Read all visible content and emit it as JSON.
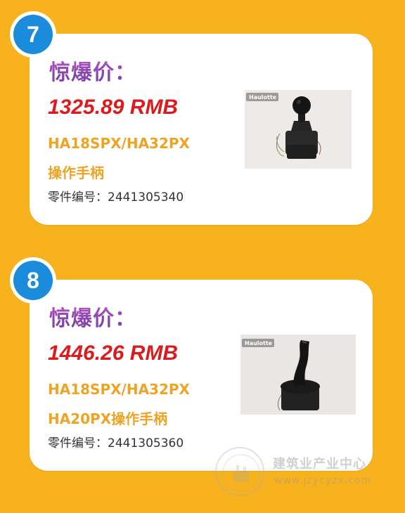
{
  "cards": [
    {
      "number": "7",
      "label": "惊爆价：",
      "price": "1325.89 RMB",
      "model_line1": "HA18SPX/HA32PX",
      "model_line2": "操作手柄",
      "part_number": "零件编号：2441305340",
      "image_logo": "Haulotte"
    },
    {
      "number": "8",
      "label": "惊爆价：",
      "price": "1446.26 RMB",
      "model_line1": "HA18SPX/HA32PX",
      "model_line2": "HA20PX操作手柄",
      "part_number": "零件编号：2441305360",
      "image_logo": "Haulotte"
    }
  ],
  "watermark": {
    "name": "建筑业产业中心",
    "url": "www.jzycyzx.com"
  },
  "colors": {
    "background": "#F7B21E",
    "badge": "#1A8CDB",
    "price": "#DB1B1E",
    "model": "#EDA425",
    "label": "#8D46B0"
  }
}
